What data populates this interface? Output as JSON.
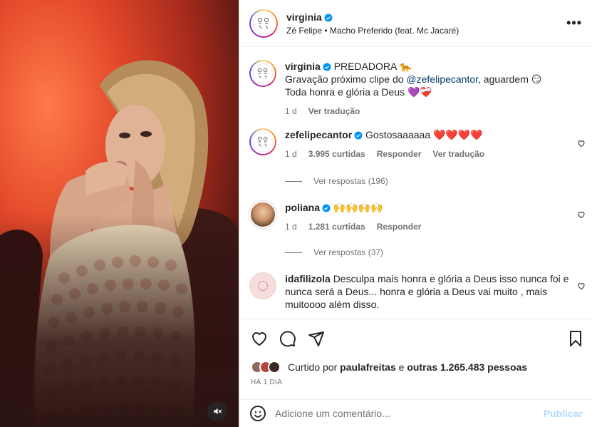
{
  "post": {
    "author": "virginia",
    "audio": "Zé Felipe • Macho Preferido (feat. Mc Jacaré)"
  },
  "caption": {
    "username": "virginia",
    "line1": "PREDADORA 🐆",
    "line2_prefix": "Gravação próximo clipe do ",
    "line2_mention": "@zefelipecantor",
    "line2_suffix": ", aguardem 😏",
    "line3": "Toda honra e glória a Deus 💜❤️‍🩹",
    "time": "1 d",
    "translate": "Ver tradução"
  },
  "comments": [
    {
      "username": "zefelipecantor",
      "text": "Gostosaaaaaa ❤️❤️❤️❤️",
      "time": "1 d",
      "likes": "3.995 curtidas",
      "reply": "Responder",
      "translate": "Ver tradução",
      "replies": "Ver respostas (196)"
    },
    {
      "username": "poliana",
      "text": "🙌🙌🙌🙌",
      "time": "1 d",
      "likes": "1.281 curtidas",
      "reply": "Responder",
      "replies": "Ver respostas (37)"
    },
    {
      "username": "idafilizola",
      "text": "Desculpa mais honra e glória a Deus isso nunca foi e nunca será a Deus... honra e glória a Deus vai muito , mais muitoooo além disso."
    }
  ],
  "likes": {
    "prefix": "Curtido por ",
    "user": "paulafreitas",
    "middle": " e ",
    "others": "outras 1.265.483 pessoas"
  },
  "time_ago": "HÁ 1 DIA",
  "comment_box": {
    "placeholder": "Adicione um comentário...",
    "publish": "Publicar"
  },
  "more_label": "•••",
  "colors": {
    "accent_link": "#00376b",
    "publish_disabled": "#b3dbff",
    "verified": "#0095f6",
    "secondary_text": "#737373"
  },
  "icons": [
    "verified-icon",
    "heart-icon",
    "comment-icon",
    "share-icon",
    "bookmark-icon",
    "emoji-icon",
    "mute-icon",
    "more-icon"
  ]
}
